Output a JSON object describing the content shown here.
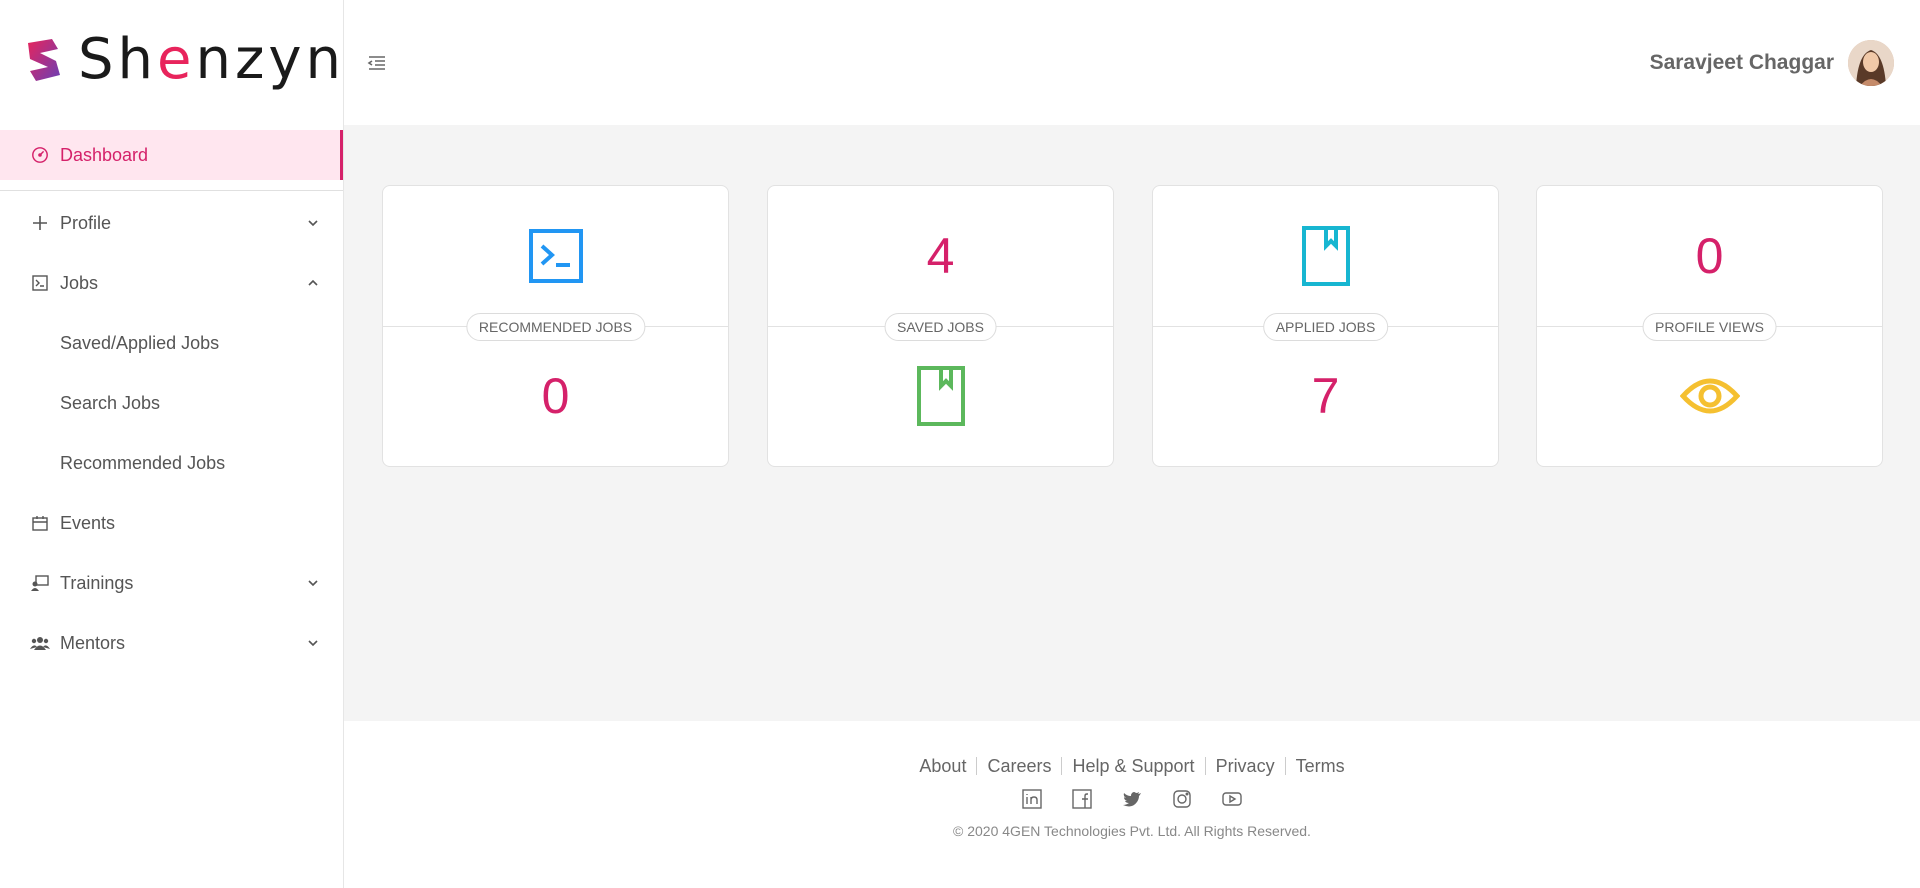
{
  "brand": {
    "name_prefix": "Sh",
    "name_accent": "e",
    "name_suffix": "nzyn"
  },
  "header": {
    "user_name": "Saravjeet Chaggar"
  },
  "sidebar": {
    "items": [
      {
        "label": "Dashboard",
        "icon": "dashboard-icon"
      },
      {
        "label": "Profile",
        "icon": "plus-icon"
      },
      {
        "label": "Jobs",
        "icon": "terminal-icon"
      },
      {
        "label": "Saved/Applied Jobs"
      },
      {
        "label": "Search Jobs"
      },
      {
        "label": "Recommended Jobs"
      },
      {
        "label": "Events",
        "icon": "calendar-icon"
      },
      {
        "label": "Trainings",
        "icon": "training-icon"
      },
      {
        "label": "Mentors",
        "icon": "users-icon"
      }
    ]
  },
  "cards": [
    {
      "label": "RECOMMENDED JOBS",
      "value": "0",
      "icon": "terminal-icon",
      "icon_color": "#2196f3"
    },
    {
      "label": "SAVED JOBS",
      "value": "4",
      "icon": "bookmark-icon",
      "icon_color": "#5cb85c"
    },
    {
      "label": "APPLIED JOBS",
      "value": "7",
      "icon": "bookmark-icon",
      "icon_color": "#17b6d1"
    },
    {
      "label": "PROFILE VIEWS",
      "value": "0",
      "icon": "eye-icon",
      "icon_color": "#f5c030"
    }
  ],
  "footer": {
    "links": [
      "About",
      "Careers",
      "Help & Support",
      "Privacy",
      "Terms"
    ],
    "social": [
      "linkedin-icon",
      "facebook-icon",
      "twitter-icon",
      "instagram-icon",
      "youtube-icon"
    ],
    "copyright": "© 2020 4GEN Technologies Pvt. Ltd. All Rights Reserved."
  },
  "colors": {
    "accent": "#d5216a",
    "active_bg": "#ffe6ef",
    "main_bg": "#f4f4f4"
  }
}
